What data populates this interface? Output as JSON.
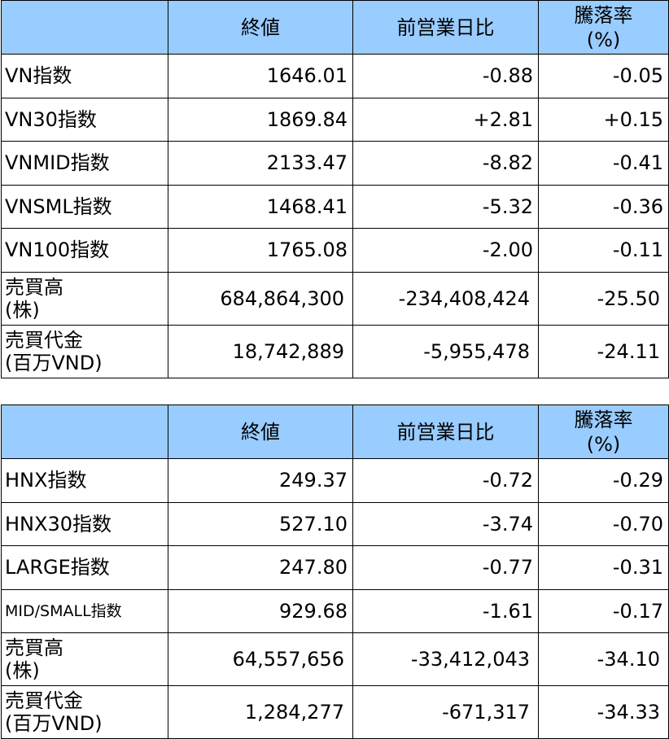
{
  "headers": {
    "close": "終値",
    "change": "前営業日比",
    "pct_line1": "騰落率",
    "pct_line2": "(%)"
  },
  "hose": {
    "rows": [
      {
        "label": "VN指数",
        "close": "1646.01",
        "change": "-0.88",
        "pct": "-0.05"
      },
      {
        "label": "VN30指数",
        "close": "1869.84",
        "change": "+2.81",
        "pct": "+0.15"
      },
      {
        "label": "VNMID指数",
        "close": "2133.47",
        "change": "-8.82",
        "pct": "-0.41"
      },
      {
        "label": "VNSML指数",
        "close": "1468.41",
        "change": "-5.32",
        "pct": "-0.36"
      },
      {
        "label": "VN100指数",
        "close": "1765.08",
        "change": "-2.00",
        "pct": "-0.11"
      }
    ],
    "volume": {
      "label1": "売買高",
      "label2": "(株)",
      "close": "684,864,300",
      "change": "-234,408,424",
      "pct": "-25.50"
    },
    "value": {
      "label1": "売買代金",
      "label2": "(百万VND)",
      "close": "18,742,889",
      "change": "-5,955,478",
      "pct": "-24.11"
    }
  },
  "hnx": {
    "rows": [
      {
        "label": "HNX指数",
        "close": "249.37",
        "change": "-0.72",
        "pct": "-0.29"
      },
      {
        "label": "HNX30指数",
        "close": "527.10",
        "change": "-3.74",
        "pct": "-0.70"
      },
      {
        "label": "LARGE指数",
        "close": "247.80",
        "change": "-0.77",
        "pct": "-0.31"
      },
      {
        "label": "MID/SMALL指数",
        "close": "929.68",
        "change": "-1.61",
        "pct": "-0.17"
      }
    ],
    "volume": {
      "label1": "売買高",
      "label2": "(株)",
      "close": "64,557,656",
      "change": "-33,412,043",
      "pct": "-34.10"
    },
    "value": {
      "label1": "売買代金",
      "label2": "(百万VND)",
      "close": "1,284,277",
      "change": "-671,317",
      "pct": "-34.33"
    }
  },
  "colors": {
    "header_bg": "#99ccff",
    "border": "#000000"
  }
}
